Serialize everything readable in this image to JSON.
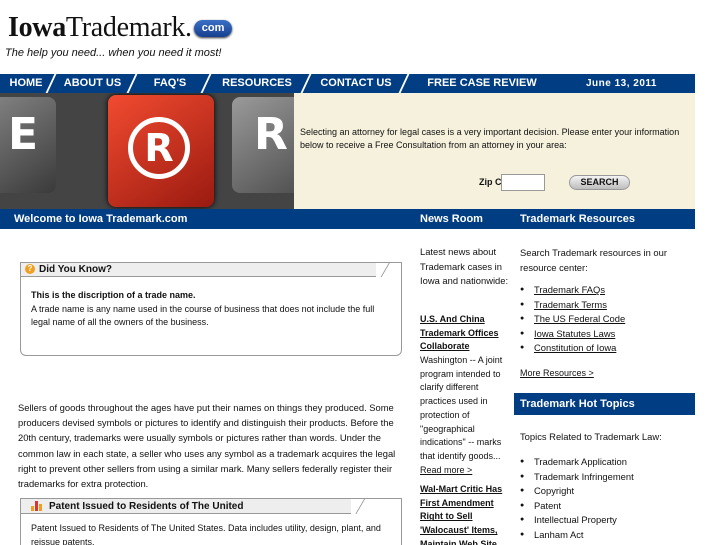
{
  "header": {
    "logo_bold": "Iowa",
    "logo_rest": "Trademark.",
    "logo_badge": "com",
    "tagline": "The help you need... when you need it most!"
  },
  "nav": {
    "items": [
      "HOME",
      "ABOUT US",
      "FAQ'S",
      "RESOURCES",
      "CONTACT US",
      "FREE CASE REVIEW"
    ],
    "date": "June 13, 2011"
  },
  "hero": {
    "key_letters": [
      "E",
      "R"
    ],
    "reg_symbol": "R",
    "text": "Selecting an attorney for legal cases is a very important decision. Please enter your information below to receive a Free Consultation from an attorney in your area:",
    "zip_label": "Zip Code:",
    "zip_value": "",
    "search_label": "SEARCH"
  },
  "sections": {
    "welcome": "Welcome to Iowa Trademark.com",
    "news": "News Room",
    "resources": "Trademark Resources"
  },
  "did_you_know": {
    "heading": "Did You Know?",
    "icon_glyph": "?",
    "title": "This is the discription of a trade name.",
    "body": "A trade name is any name used in the course of business that does not include the full legal name of all the owners of the business."
  },
  "main_paragraph": "Sellers of goods throughout the ages have put their names on things they produced. Some producers devised symbols or pictures to identify and distinguish their products. Before the 20th century, trademarks were usually symbols or pictures rather than words. Under the common law in each state, a seller who uses any symbol as a trademark acquires the legal right to prevent other sellers from using a similar mark. Many sellers federally register their trademarks for extra protection.",
  "patent": {
    "heading": "Patent Issued to Residents of The United",
    "body": "Patent Issued to Residents of The United States. Data includes utility, design, plant, and reissue patents."
  },
  "news": {
    "intro": "Latest news about Trademark cases in Iowa and nationwide:",
    "item1_title": "U.S. And China Trademark Offices Collaborate",
    "item1_body": "Washington -- A joint program intended to clarify different practices used in protection of \"geographical indications\" -- marks that identify goods...",
    "item1_read": "Read more >",
    "item2_title": "Wal-Mart Critic Has First Amendment Right to Sell 'Walocaust' Items, Maintain Web Site"
  },
  "resources": {
    "intro": "Search Trademark resources in our resource center:",
    "links": [
      "Trademark FAQs",
      "Trademark Terms",
      "The US Federal Code",
      "Iowa Statutes Laws",
      "Constitution of Iowa"
    ],
    "more": "More Resources >"
  },
  "hot_topics": {
    "heading": "Trademark Hot Topics",
    "intro": "Topics Related to Trademark Law:",
    "items": [
      "Trademark Application",
      "Trademark Infringement",
      "Copyright",
      "Patent",
      "Intellectual Property",
      "Lanham Act"
    ]
  },
  "colors": {
    "nav_blue": "#003d82",
    "form_bg": "#f5f1dc",
    "key_red": "#e0321e"
  }
}
